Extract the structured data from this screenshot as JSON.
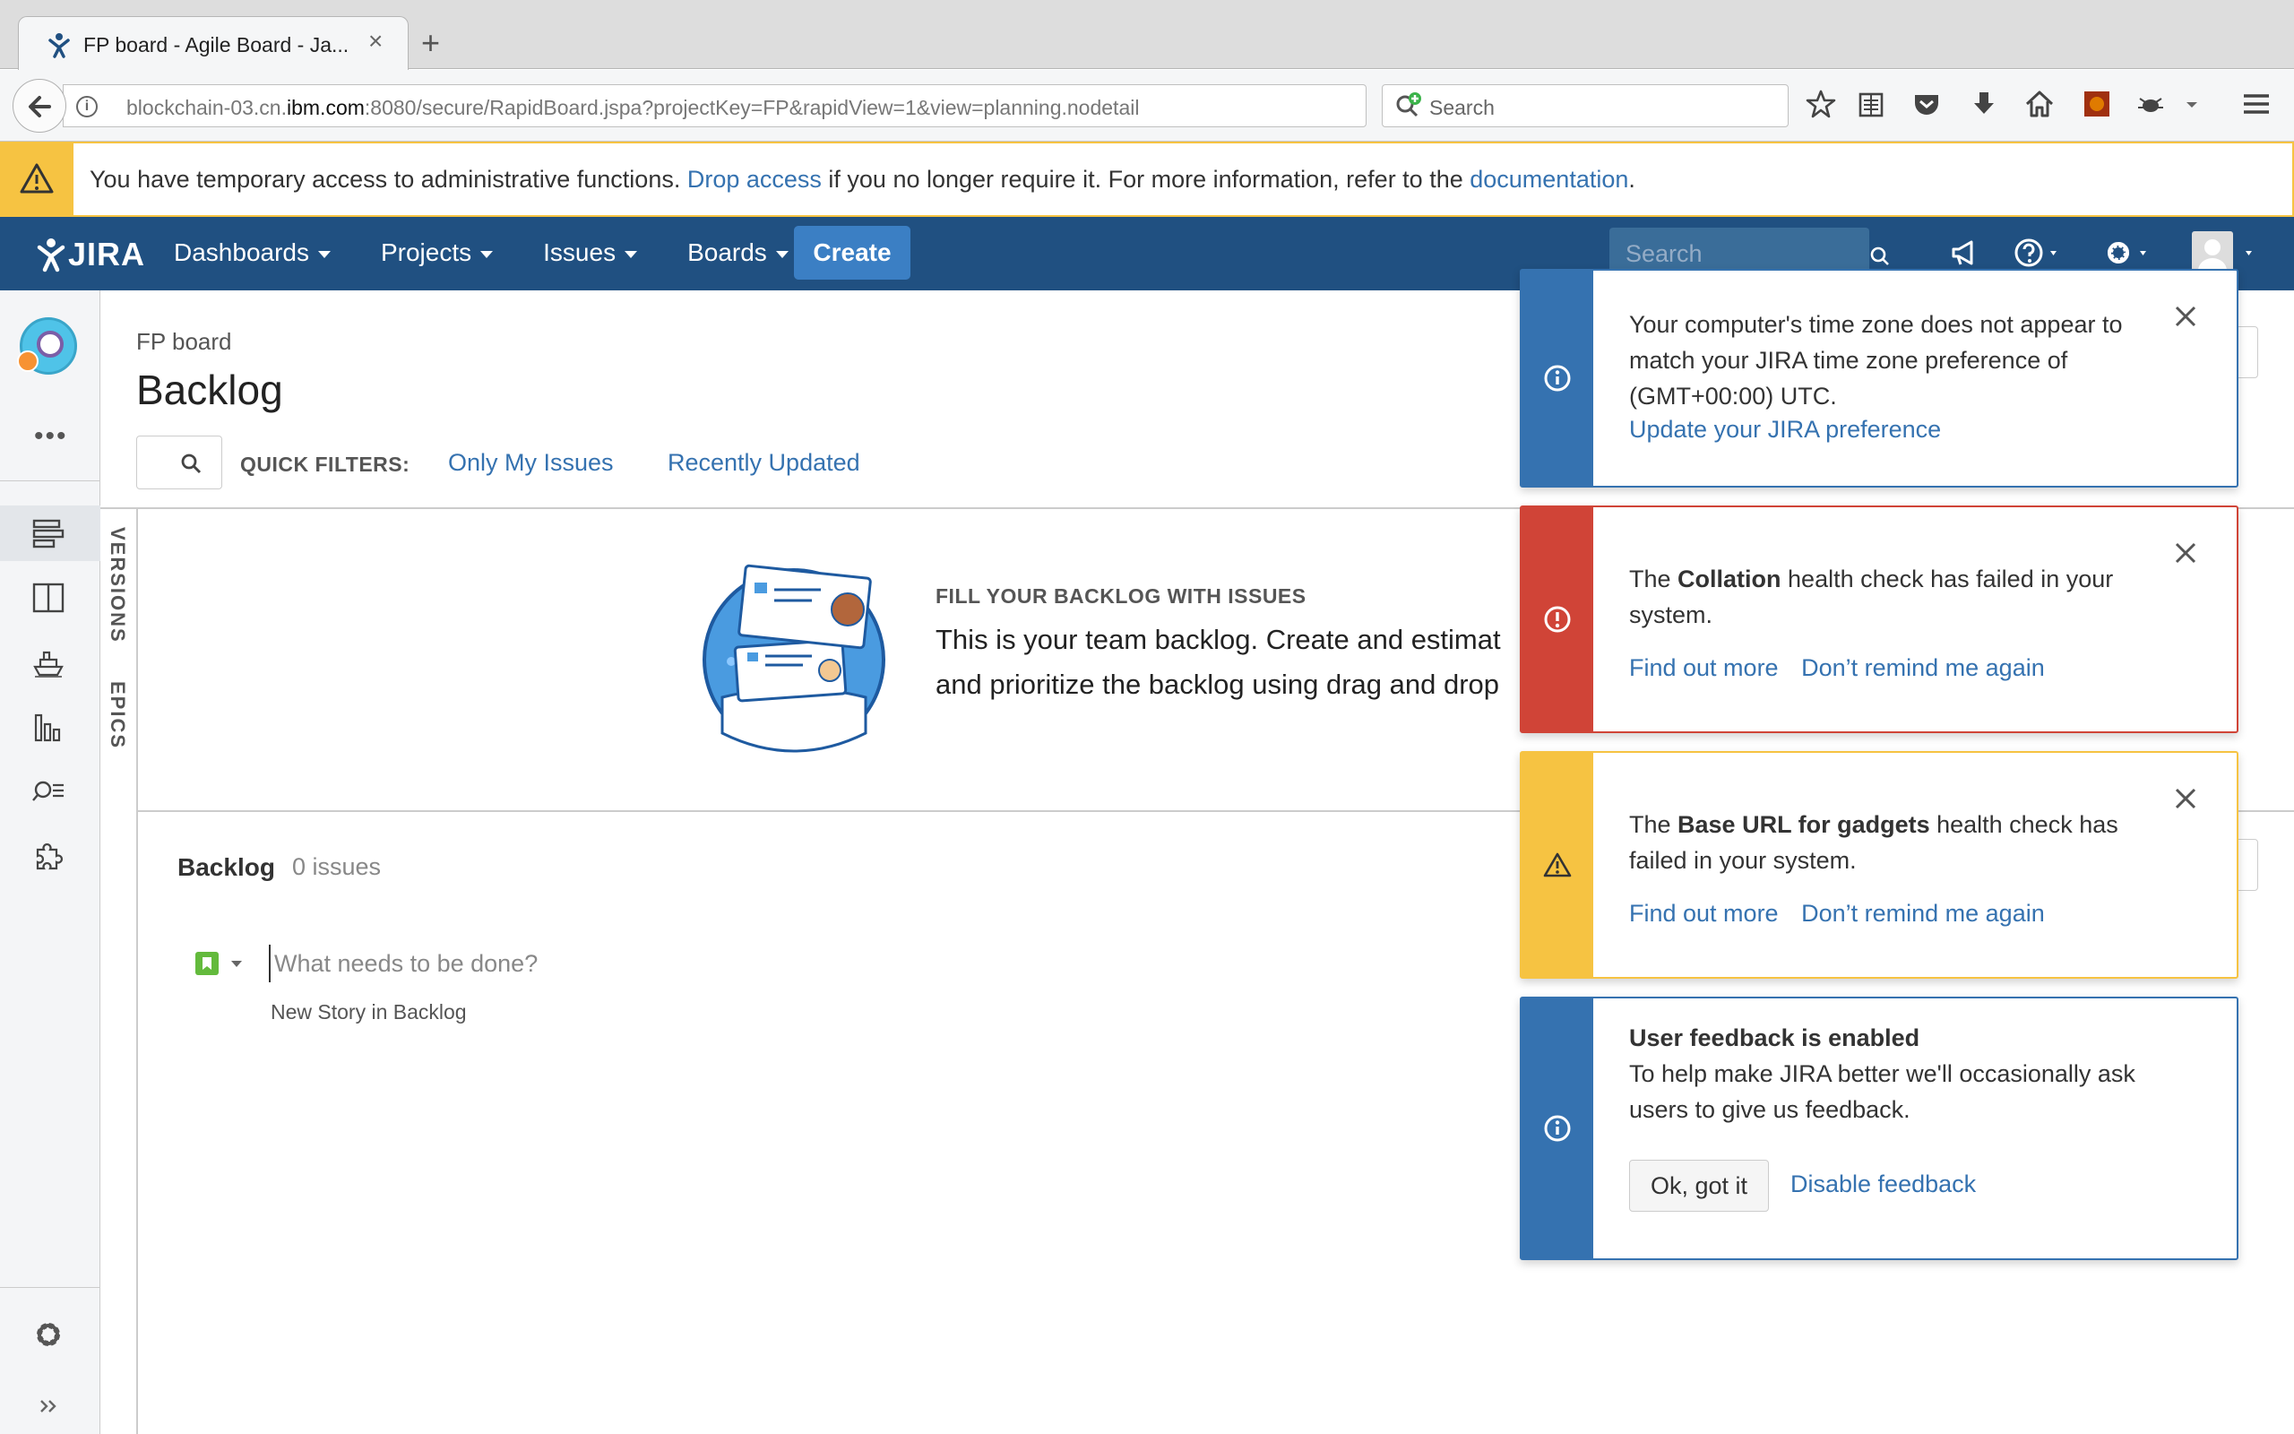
{
  "browser": {
    "tab_title": "FP board - Agile Board - Ja...",
    "tab_close": "×",
    "new_tab": "+",
    "url_prefix": "blockchain-03.cn.",
    "url_domain": "ibm.com",
    "url_suffix": ":8080/secure/RapidBoard.jspa?projectKey=FP&rapidView=1&view=planning.nodetail",
    "search_placeholder": "Search"
  },
  "admin_banner": {
    "text_before": "You have temporary access to administrative functions. ",
    "drop_access_link": "Drop access",
    "text_middle": " if you no longer require it. For more information, refer to the ",
    "documentation_link": "documentation",
    "text_after": "."
  },
  "header": {
    "logo": "JIRA",
    "nav": [
      "Dashboards",
      "Projects",
      "Issues",
      "Boards"
    ],
    "create_label": "Create",
    "search_placeholder": "Search"
  },
  "main": {
    "board_name": "FP board",
    "title": "Backlog",
    "quick_filters_label": "QUICK FILTERS:",
    "quick_filters": [
      "Only My Issues",
      "Recently Updated"
    ],
    "vertical_tabs": [
      "VERSIONS",
      "EPICS"
    ],
    "empty_state": {
      "title": "FILL YOUR BACKLOG WITH ISSUES",
      "line1": "This is your team backlog. Create and estimat",
      "line2": "and prioritize the backlog using drag and drop"
    },
    "backlog": {
      "label": "Backlog",
      "count": "0 issues",
      "input_placeholder": "What needs to be done?",
      "hint": "New Story in Backlog"
    }
  },
  "flags": [
    {
      "type": "info",
      "color": "#3572b0",
      "text": "Your computer's time zone does not appear to match your JIRA time zone preference of (GMT+00:00) UTC.",
      "link": "Update your JIRA preference"
    },
    {
      "type": "error",
      "color": "#d04437",
      "text_before": "The ",
      "bold": "Collation",
      "text_after": " health check has failed in your system.",
      "links": [
        "Find out more",
        "Don’t remind me again"
      ]
    },
    {
      "type": "warning",
      "color": "#f6c342",
      "text_before": "The ",
      "bold": "Base URL for gadgets",
      "text_after": " health check has failed in your system.",
      "links": [
        "Find out more",
        "Don’t remind me again"
      ]
    },
    {
      "type": "info",
      "color": "#3572b0",
      "title": "User feedback is enabled",
      "text": "To help make JIRA better we'll occasionally ask users to give us feedback.",
      "ok_button": "Ok, got it",
      "link": "Disable feedback"
    }
  ],
  "colors": {
    "jira_blue": "#205081",
    "link": "#3572b0",
    "create_button": "#3b7fc4",
    "warning": "#f6c342",
    "error": "#d04437",
    "story_green": "#63ba3c"
  }
}
